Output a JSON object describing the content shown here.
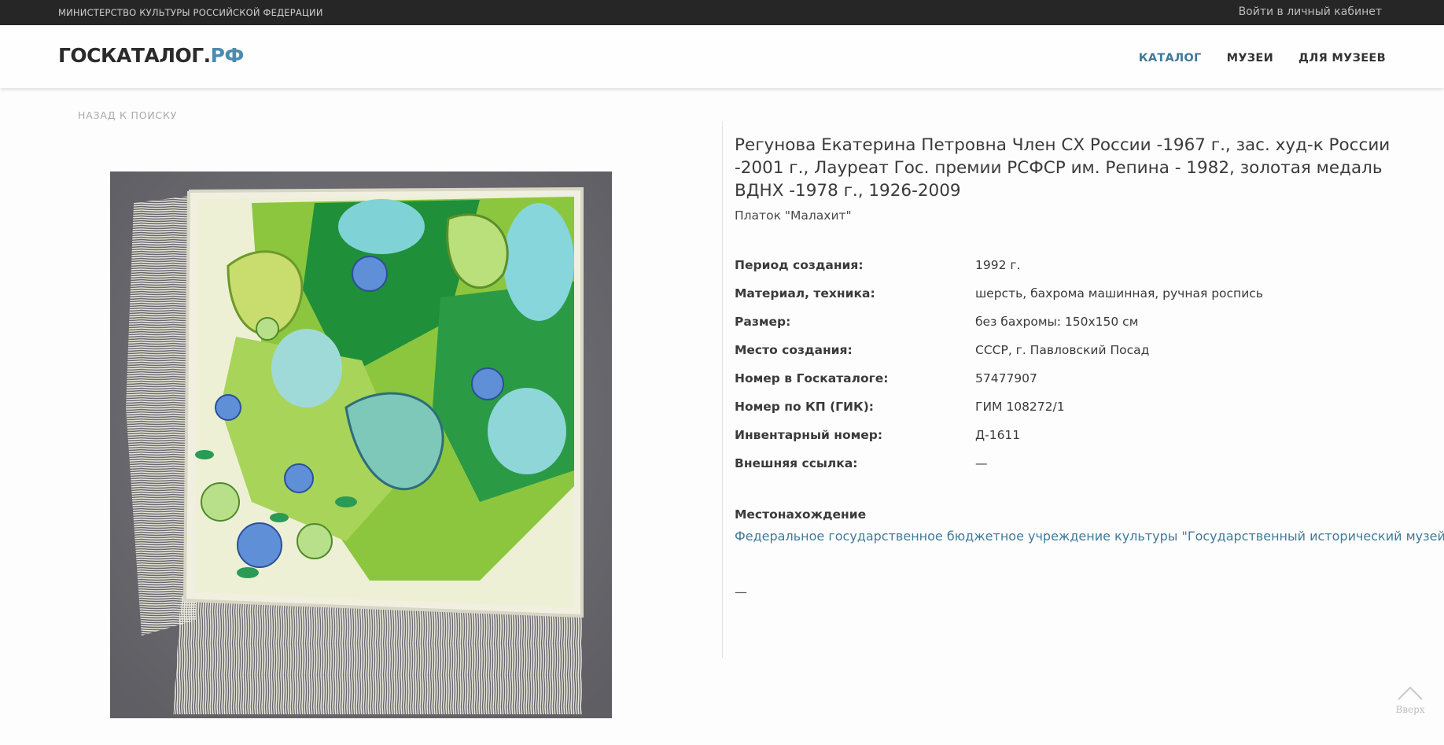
{
  "topbar": {
    "ministry": "МИНИСТЕРСТВО КУЛЬТУРЫ РОССИЙСКОЙ ФЕДЕРАЦИИ",
    "login": "Войти в личный кабинет"
  },
  "header": {
    "logo_main": "ГОСКАТАЛОГ.",
    "logo_accent": "РФ",
    "nav": [
      {
        "label": "КАТАЛОГ",
        "active": true
      },
      {
        "label": "МУЗЕИ",
        "active": false
      },
      {
        "label": "ДЛЯ МУЗЕЕВ",
        "active": false
      }
    ]
  },
  "back_link": "НАЗАД К ПОИСКУ",
  "item": {
    "title": "Регунова Екатерина Петровна Член СХ России -1967 г., зас. худ-к России -2001 г., Лауреат Гос. премии РСФСР им. Репина - 1982, золотая медаль ВДНХ -1978 г., 1926-2009",
    "subtitle": "Платок \"Малахит\"",
    "attributes": [
      {
        "key": "Период создания:",
        "value": "1992 г."
      },
      {
        "key": "Материал, техника:",
        "value": "шерсть, бахрома машинная, ручная роспись"
      },
      {
        "key": "Размер:",
        "value": "без бахромы: 150х150 см"
      },
      {
        "key": "Место создания:",
        "value": "СССР, г. Павловский Посад"
      },
      {
        "key": "Номер в Госкаталоге:",
        "value": "57477907"
      },
      {
        "key": "Номер по КП (ГИК):",
        "value": "ГИМ 108272/1"
      },
      {
        "key": "Инвентарный номер:",
        "value": "Д-1611"
      },
      {
        "key": "Внешняя ссылка:",
        "value": "—"
      }
    ],
    "location_heading": "Местонахождение",
    "location_link": "Федеральное государственное бюджетное учреждение культуры \"Государственный исторический музей\"",
    "trailing_dash": "—"
  },
  "to_top": "Вверх",
  "colors": {
    "accent": "#3f7a99",
    "topbar": "#262626",
    "photo_bg": "#6e6e72"
  }
}
